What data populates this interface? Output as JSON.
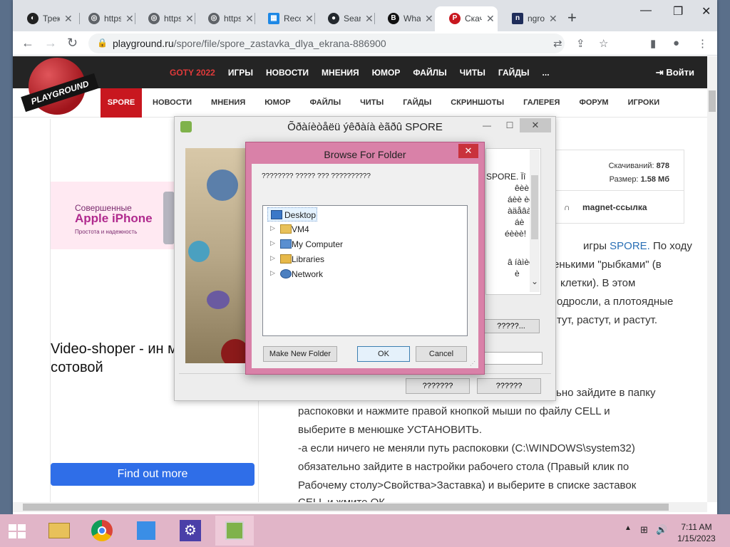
{
  "browser": {
    "tabs": [
      {
        "label": "Трек",
        "icon": "tracker-icon",
        "color": "#1a1a1a"
      },
      {
        "label": "https",
        "icon": "globe-icon",
        "color": "#5f6368"
      },
      {
        "label": "https",
        "icon": "globe-icon",
        "color": "#5f6368"
      },
      {
        "label": "https",
        "icon": "globe-icon",
        "color": "#5f6368"
      },
      {
        "label": "Reco",
        "icon": "windows-icon",
        "color": "#1e88e5"
      },
      {
        "label": "Search",
        "icon": "github-icon",
        "color": "#24292e"
      },
      {
        "label": "What",
        "icon": "bb-icon",
        "color": "#111"
      },
      {
        "label": "Скач",
        "icon": "playground-icon",
        "color": "#c8171f"
      },
      {
        "label": "ngrok",
        "icon": "ngrok-icon",
        "color": "#1f2d5a"
      }
    ],
    "url_host": "playground.ru",
    "url_path": "/spore/file/spore_zastavka_dlya_ekrana-886900"
  },
  "site": {
    "logo": "PLAYGROUND",
    "topnav": [
      "GOTY 2022",
      "ИГРЫ",
      "НОВОСТИ",
      "МНЕНИЯ",
      "ЮМОР",
      "ФАЙЛЫ",
      "ЧИТЫ",
      "ГАЙДЫ",
      "..."
    ],
    "login": "Войти",
    "subnav_active": "SPORE",
    "subnav": [
      "НОВОСТИ",
      "МНЕНИЯ",
      "ЮМОР",
      "ФАЙЛЫ",
      "ЧИТЫ",
      "ГАЙДЫ",
      "СКРИНШОТЫ",
      "ГАЛЕРЕЯ",
      "ФОРУМ",
      "ИГРОКИ"
    ]
  },
  "ad": {
    "line1": "Совершенные",
    "line2": "Apple iPhone",
    "line3": "Простота и надежность",
    "video_title": "Video-shoper - ин магазин сотовой",
    "button": "Find out more"
  },
  "download": {
    "downloads_label": "Скачиваний:",
    "downloads_value": "878",
    "size_label": "Размер:",
    "size_value": "1.58 Мб",
    "magnet": "magnet-ссылка"
  },
  "article": {
    "p1": [
      "игры ",
      "SPORE.",
      " По ходу",
      "енькими \"рыбками\" (в",
      "клетки). В этом",
      "одросли, а плотоядные",
      "тут, растут, и растут."
    ],
    "p2": [
      "ьно зайдите в папку",
      "распоковки и нажмите правой кнопкой мыши по файлу CELL и",
      "выберите в менюшке УСТАНОВИТЬ.",
      "-а если ничего не меняли путь распоковки (C:\\WINDOWS\\system32)",
      "обязательно зайдите в настройки рабочего стола (Правый клик по",
      "Рабочему столу>Свойства>Заставка) и выберите в списке заставок",
      "CELL и жмите ОК"
    ]
  },
  "installer": {
    "title": "Õðàíèòåëü ýêðàíà èãðû SPORE",
    "text_lines": [
      "SPORE. Ïî",
      "êèè",
      "áèè èèè",
      "àäåâàò",
      "áè",
      "éèèè!",
      "",
      "â íàìèò",
      "è"
    ],
    "browse_button": "?????...",
    "button1": "???????",
    "button2": "??????"
  },
  "bff": {
    "title": "Browse For Folder",
    "description": "???????? ????? ??? ??????????",
    "tree": [
      {
        "name": "Desktop",
        "icon": "desktop-icon",
        "expand": false,
        "selected": true
      },
      {
        "name": "VM4",
        "icon": "user-folder-icon",
        "expand": true,
        "selected": false
      },
      {
        "name": "My Computer",
        "icon": "computer-icon",
        "expand": true,
        "selected": false
      },
      {
        "name": "Libraries",
        "icon": "libraries-icon",
        "expand": true,
        "selected": false
      },
      {
        "name": "Network",
        "icon": "network-icon",
        "expand": true,
        "selected": false
      }
    ],
    "make_new_folder": "Make New Folder",
    "ok": "OK",
    "cancel": "Cancel"
  },
  "taskbar": {
    "items": [
      "explorer-icon",
      "chrome-icon",
      "remote-desktop-icon",
      "settings-icon",
      "installer-icon"
    ],
    "time": "7:11 AM",
    "date": "1/15/2023"
  }
}
